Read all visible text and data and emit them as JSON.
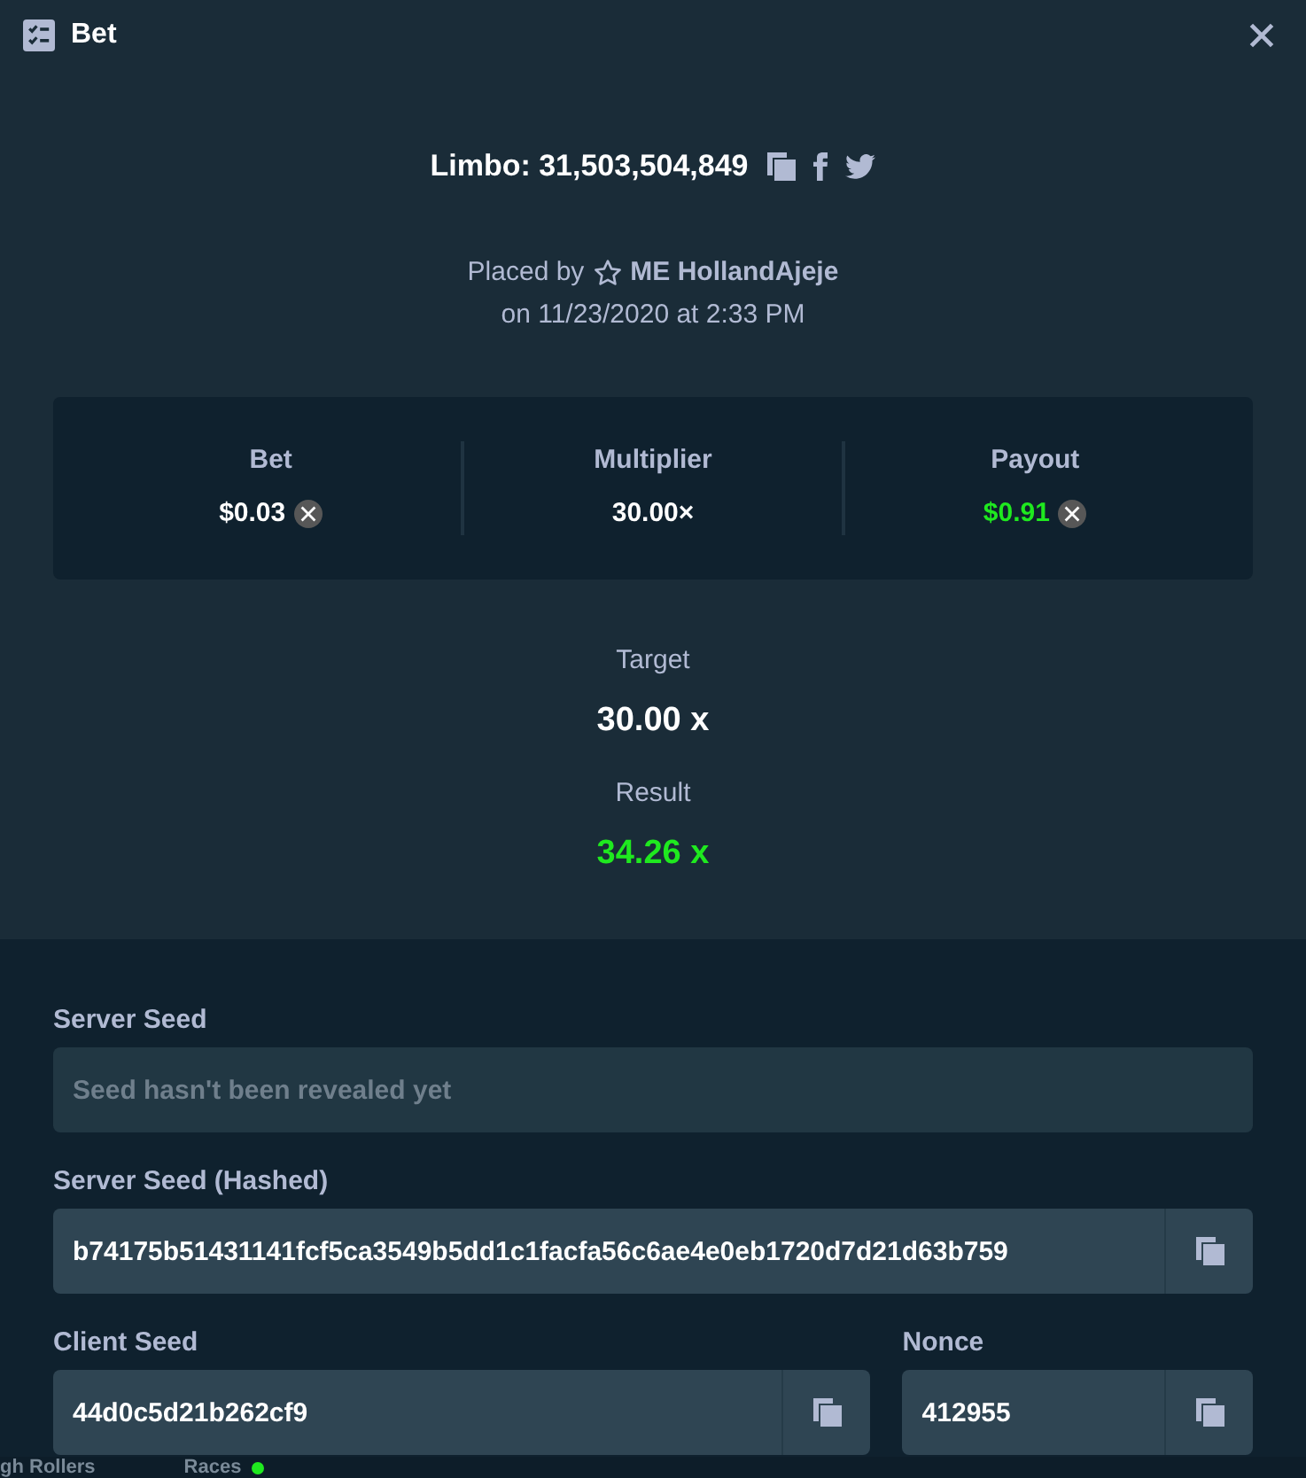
{
  "window": {
    "title": "Bet"
  },
  "bet": {
    "title": "Limbo: 31,503,504,849",
    "placed_by_label": "Placed by",
    "player": "ME HollandAjeje",
    "placed_on": "on 11/23/2020 at 2:33 PM"
  },
  "stats": [
    {
      "label": "Bet",
      "value": "$0.03",
      "currency_icon": true,
      "positive": false
    },
    {
      "label": "Multiplier",
      "value": "30.00×",
      "currency_icon": false,
      "positive": false
    },
    {
      "label": "Payout",
      "value": "$0.91",
      "currency_icon": true,
      "positive": true
    }
  ],
  "outcome": [
    {
      "label": "Target",
      "value": "30.00 x",
      "positive": false
    },
    {
      "label": "Result",
      "value": "34.26 x",
      "positive": true
    }
  ],
  "seed_rows": [
    {
      "fields": [
        {
          "label": "Server Seed",
          "placeholder": "Seed hasn't been revealed yet",
          "disabled": true,
          "copyable": false
        }
      ]
    },
    {
      "fields": [
        {
          "label": "Server Seed (Hashed)",
          "value": "b74175b51431141fcf5ca3549b5dd1c1facfa56c6ae4e0eb1720d7d21d63b759",
          "disabled": false,
          "copyable": true
        }
      ]
    },
    {
      "fields": [
        {
          "label": "Client Seed",
          "value": "44d0c5d21b262cf9",
          "disabled": false,
          "copyable": true
        },
        {
          "label": "Nonce",
          "value": "412955",
          "disabled": false,
          "copyable": true
        }
      ]
    }
  ],
  "background_tabs": [
    {
      "label": "gh Rollers",
      "live": false
    },
    {
      "label": "Races",
      "live": true
    }
  ]
}
